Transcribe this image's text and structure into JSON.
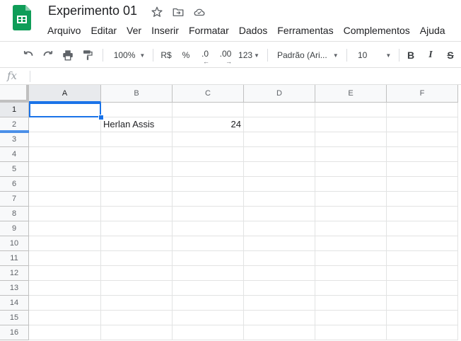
{
  "document": {
    "title": "Experimento 01"
  },
  "title_icons": [
    "star-icon",
    "move-to-folder-icon",
    "cloud-status-icon"
  ],
  "menu": [
    "Arquivo",
    "Editar",
    "Ver",
    "Inserir",
    "Formatar",
    "Dados",
    "Ferramentas",
    "Complementos",
    "Ajuda"
  ],
  "toolbar": {
    "zoom": "100%",
    "currency": "R$",
    "percent": "%",
    "decrease_decimals": ".0",
    "increase_decimals": ".00",
    "number_format": "123",
    "font": "Padrão (Ari...",
    "font_size": "10",
    "bold": "B",
    "italic": "I",
    "strikethrough": "S"
  },
  "formula_bar": {
    "label": "fx",
    "value": ""
  },
  "columns": [
    "A",
    "B",
    "C",
    "D",
    "E",
    "F"
  ],
  "rows": [
    "1",
    "2",
    "3",
    "4",
    "5",
    "6",
    "7",
    "8",
    "9",
    "10",
    "11",
    "12",
    "13",
    "14",
    "15",
    "16"
  ],
  "cells": {
    "B2": "Herlan Assis",
    "C2": "24"
  },
  "selection": {
    "active_cell": "A1"
  },
  "colors": {
    "accent": "#1a73e8",
    "logo": "#0f9d58"
  }
}
